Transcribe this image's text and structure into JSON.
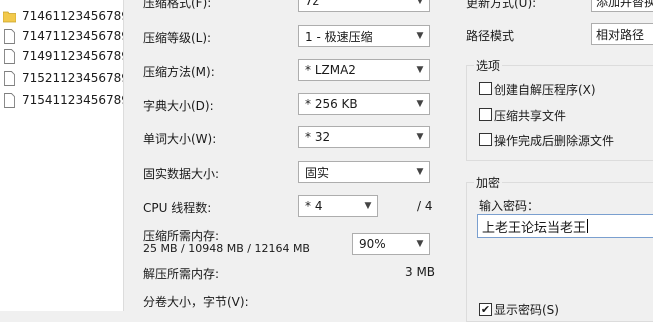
{
  "files": [
    {
      "name": "71461123456789",
      "icon": "folder-icon"
    },
    {
      "name": "71471123456789",
      "icon": "file-icon"
    },
    {
      "name": "71491123456789",
      "icon": "file-icon"
    },
    {
      "name": "71521123456789",
      "icon": "file-icon"
    },
    {
      "name": "71541123456789",
      "icon": "file-icon"
    }
  ],
  "settings": {
    "archive_format": {
      "label": "压缩格式(F):",
      "value": "7z"
    },
    "compression_level": {
      "label": "压缩等级(L):",
      "value": "1 - 极速压缩"
    },
    "compression_method": {
      "label": "压缩方法(M):",
      "value": "* LZMA2"
    },
    "dictionary_size": {
      "label": "字典大小(D):",
      "value": "* 256 KB"
    },
    "word_size": {
      "label": "单词大小(W):",
      "value": "* 32"
    },
    "solid_block_size": {
      "label": "固实数据大小:",
      "value": "固实"
    },
    "cpu_threads": {
      "label": "CPU 线程数:",
      "value": "* 4",
      "max": "/ 4"
    },
    "memory_compress": {
      "label": "压缩所需内存:",
      "detail": "25 MB / 10948 MB / 12164 MB",
      "value": "90%"
    },
    "memory_decompress": {
      "label": "解压所需内存:",
      "value": "3 MB"
    },
    "split_volume": {
      "label": "分卷大小，字节(V):"
    }
  },
  "right": {
    "update_mode": {
      "label": "更新方式(U):",
      "value": "添加并替换"
    },
    "path_mode": {
      "label": "路径模式",
      "value": "相对路径"
    },
    "options": {
      "title": "选项",
      "items": [
        {
          "label": "创建自解压程序(X)",
          "checked": false
        },
        {
          "label": "压缩共享文件",
          "checked": false
        },
        {
          "label": "操作完成后删除源文件",
          "checked": false
        }
      ]
    },
    "encryption": {
      "title": "加密",
      "password_label": "输入密码：",
      "password_value": "上老王论坛当老王",
      "show_password_label": "显示密码(S)",
      "show_password_checked": true
    }
  }
}
